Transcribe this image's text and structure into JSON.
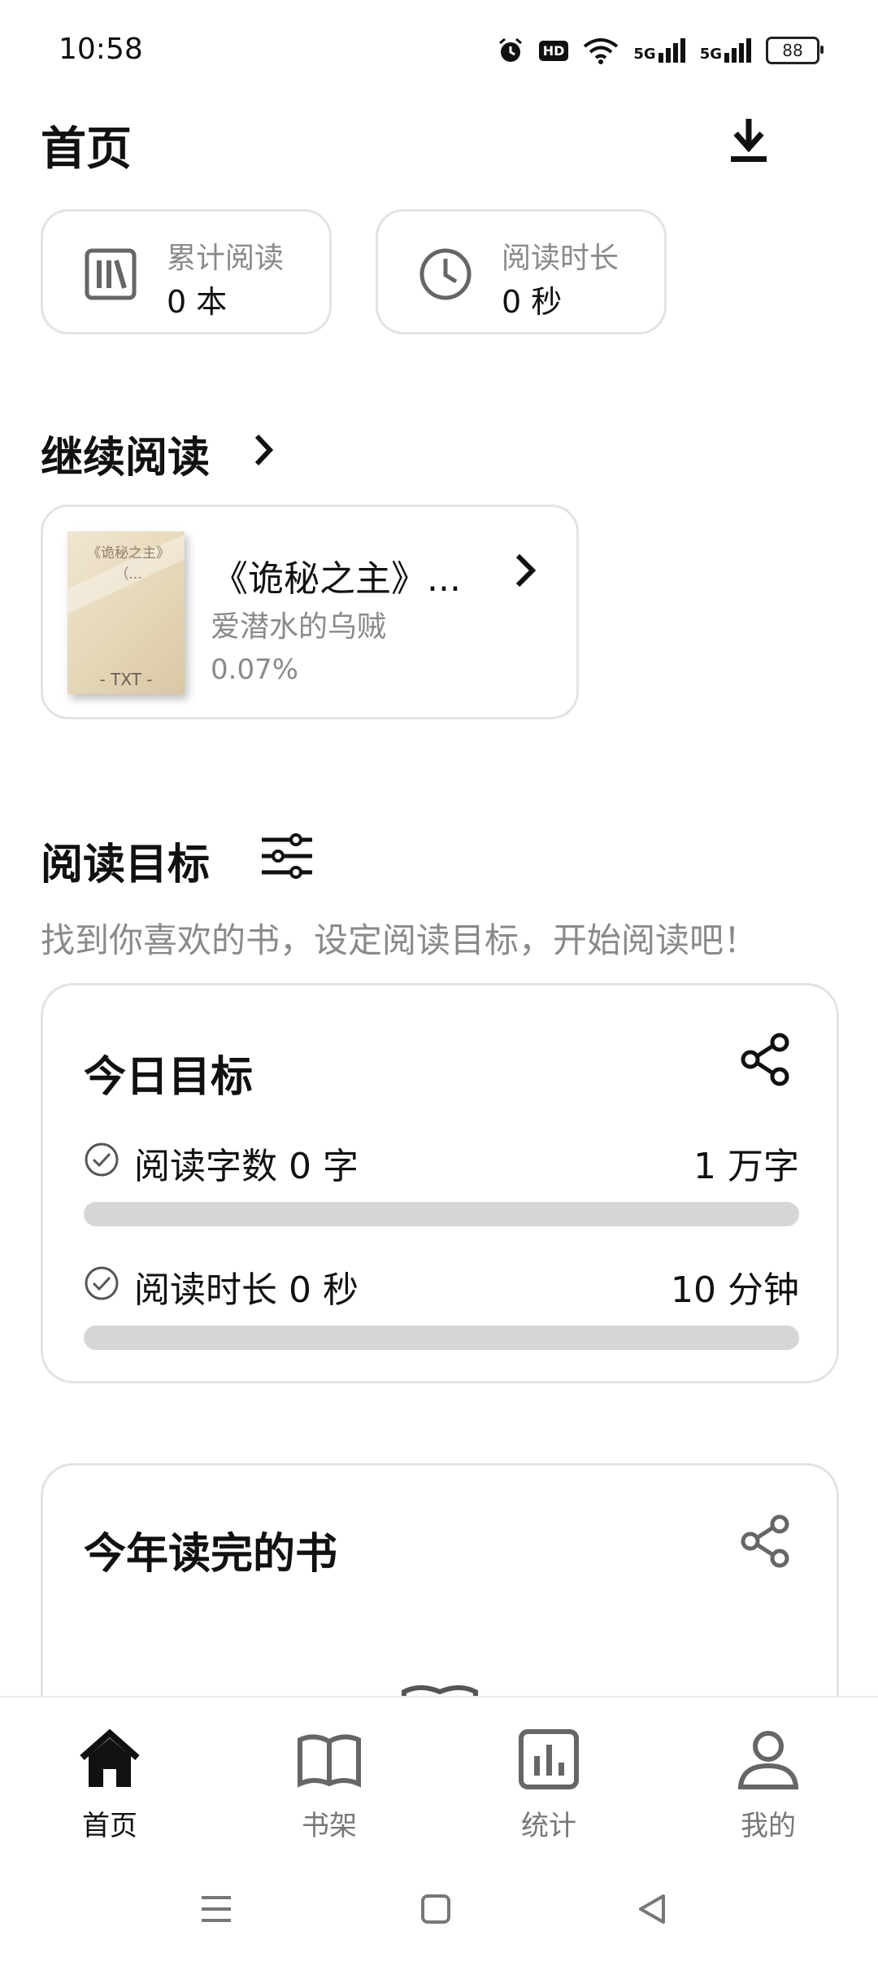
{
  "status_bar": {
    "time": "10:58",
    "battery": "88",
    "hd_label": "HD",
    "net1": "5G",
    "net2": "5G"
  },
  "header": {
    "title": "首页"
  },
  "stats": [
    {
      "label": "累计阅读",
      "value": "0 本"
    },
    {
      "label": "阅读时长",
      "value": "0 秒"
    }
  ],
  "continue_reading": {
    "title": "继续阅读",
    "book": {
      "cover_text": "《诡秘之主》（...",
      "cover_tag": "- TXT -",
      "title": "《诡秘之主》...",
      "author": "爱潜水的乌贼",
      "progress": "0.07%"
    }
  },
  "reading_goals": {
    "title": "阅读目标",
    "hint": "找到你喜欢的书，设定阅读目标，开始阅读吧！",
    "today": {
      "title": "今日目标",
      "rows": [
        {
          "label": "阅读字数 0 字",
          "target": "1 万字",
          "progress": 0
        },
        {
          "label": "阅读时长 0 秒",
          "target": "10 分钟",
          "progress": 0
        }
      ]
    }
  },
  "year_books": {
    "title": "今年读完的书"
  },
  "bottom_nav": [
    {
      "label": "首页",
      "active": true
    },
    {
      "label": "书架",
      "active": false
    },
    {
      "label": "统计",
      "active": false
    },
    {
      "label": "我的",
      "active": false
    }
  ]
}
